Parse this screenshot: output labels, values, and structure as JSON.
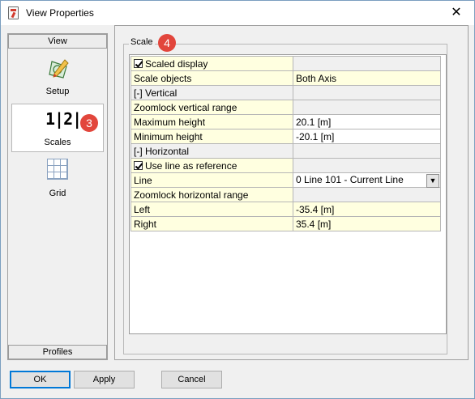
{
  "window": {
    "title": "View Properties",
    "close_glyph": "✕"
  },
  "left_panel": {
    "header": "View",
    "footer": "Profiles",
    "items": [
      {
        "label": "Setup",
        "icon": "setup-icon"
      },
      {
        "label": "Scales",
        "icon": "scales-icon",
        "glyph": "1|2|"
      },
      {
        "label": "Grid",
        "icon": "grid-icon"
      }
    ]
  },
  "annotations": {
    "scales_badge": "3",
    "scale_badge": "4"
  },
  "group": {
    "legend": "Scale"
  },
  "properties": [
    {
      "label": "Scaled display",
      "checkbox": true,
      "checked": true,
      "value": ""
    },
    {
      "label": "Scale objects",
      "value": "Both Axis"
    },
    {
      "label": "[-] Vertical",
      "section": true,
      "value": ""
    },
    {
      "label": "Zoomlock vertical range",
      "value": ""
    },
    {
      "label": "Maximum height",
      "value": "20.1 [m]"
    },
    {
      "label": "Minimum height",
      "value": "-20.1 [m]"
    },
    {
      "label": "[-] Horizontal",
      "section": true,
      "value": ""
    },
    {
      "label": "Use line as reference",
      "checkbox": true,
      "checked": true,
      "value": ""
    },
    {
      "label": "Line",
      "value": "0 Line 101 - Current Line",
      "dropdown": true
    },
    {
      "label": "Zoomlock horizontal range",
      "value": ""
    },
    {
      "label": "Left",
      "value": "-35.4 [m]"
    },
    {
      "label": "Right",
      "value": "35.4 [m]"
    }
  ],
  "buttons": {
    "ok": "OK",
    "apply": "Apply",
    "cancel": "Cancel"
  },
  "colors": {
    "accent": "#0078d7",
    "badge": "#e2463c",
    "row_yellow": "#ffffe0"
  }
}
